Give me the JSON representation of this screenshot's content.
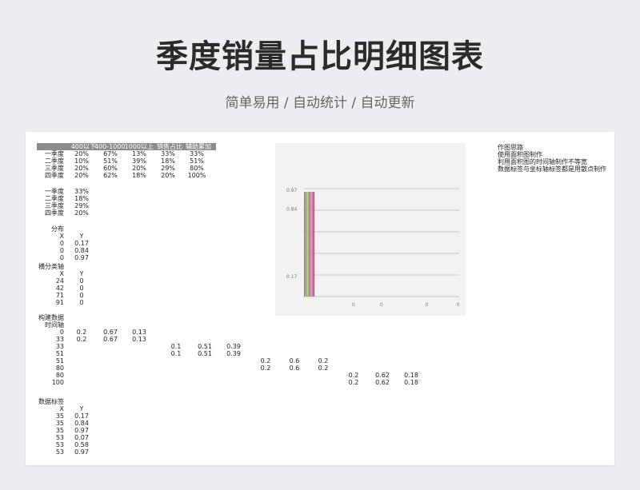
{
  "header": {
    "title": "季度销量占比明细图表",
    "subtitle": "简单易用 / 自动统计 / 自动更新"
  },
  "sheet": {
    "table1": {
      "headers": [
        "400以下",
        "400-1000",
        "1000以上",
        "销售占比",
        "辅助累加"
      ],
      "rows": [
        {
          "label": "一季度",
          "values": [
            "20%",
            "67%",
            "13%",
            "33%",
            "33%"
          ]
        },
        {
          "label": "二季度",
          "values": [
            "10%",
            "51%",
            "39%",
            "18%",
            "51%"
          ]
        },
        {
          "label": "三季度",
          "values": [
            "20%",
            "60%",
            "20%",
            "29%",
            "80%"
          ]
        },
        {
          "label": "四季度",
          "values": [
            "20%",
            "62%",
            "18%",
            "20%",
            "100%"
          ]
        }
      ]
    },
    "table2": {
      "rows": [
        {
          "label": "一季度",
          "value": "33%"
        },
        {
          "label": "二季度",
          "value": "18%"
        },
        {
          "label": "三季度",
          "value": "29%"
        },
        {
          "label": "四季度",
          "value": "20%"
        }
      ]
    },
    "distribution": {
      "title": "分布",
      "x_header": "X",
      "y_header": "Y",
      "rows": [
        [
          "0",
          "0.17"
        ],
        [
          "0",
          "0.84"
        ],
        [
          "0",
          "0.97"
        ]
      ]
    },
    "category_axis": {
      "title": "横分类轴",
      "x_header": "X",
      "y_header": "Y",
      "rows": [
        [
          "24",
          "0"
        ],
        [
          "42",
          "0"
        ],
        [
          "71",
          "0"
        ],
        [
          "91",
          "0"
        ]
      ]
    },
    "build": {
      "title": "构建数据",
      "subtitle": "时间轴",
      "rows": [
        {
          "t": "0",
          "cols": [
            [
              "0.2",
              "0.67",
              "0.13"
            ],
            null,
            null,
            null
          ]
        },
        {
          "t": "33",
          "cols": [
            [
              "0.2",
              "0.67",
              "0.13"
            ],
            null,
            null,
            null
          ]
        },
        {
          "t": "33",
          "cols": [
            null,
            [
              "0.1",
              "0.51",
              "0.39"
            ],
            null,
            null
          ]
        },
        {
          "t": "51",
          "cols": [
            null,
            [
              "0.1",
              "0.51",
              "0.39"
            ],
            null,
            null
          ]
        },
        {
          "t": "51",
          "cols": [
            null,
            null,
            [
              "0.2",
              "0.6",
              "0.2"
            ],
            null
          ]
        },
        {
          "t": "80",
          "cols": [
            null,
            null,
            [
              "0.2",
              "0.6",
              "0.2"
            ],
            null
          ]
        },
        {
          "t": "80",
          "cols": [
            null,
            null,
            null,
            [
              "0.2",
              "0.62",
              "0.18"
            ]
          ]
        },
        {
          "t": "100",
          "cols": [
            null,
            null,
            null,
            [
              "0.2",
              "0.62",
              "0.18"
            ]
          ]
        }
      ]
    },
    "data_labels": {
      "title": "数据标签",
      "x_header": "X",
      "y_header": "Y",
      "rows": [
        [
          "35",
          "0.17"
        ],
        [
          "35",
          "0.84"
        ],
        [
          "35",
          "0.97"
        ],
        [
          "53",
          "0.07"
        ],
        [
          "53",
          "0.58"
        ],
        [
          "53",
          "0.97"
        ]
      ]
    },
    "notes": [
      "作图思路",
      "使用面积图制作",
      "利用面积图的时间轴制作不等宽",
      "数据标签与坐标轴标签都是用散点制作"
    ]
  },
  "chart_data": {
    "type": "area",
    "y_tick_labels": [
      "0.97",
      "0.84",
      "0.17"
    ],
    "y_tick_values": [
      0.97,
      0.84,
      0.17
    ],
    "x_tick_labels": [
      "0",
      "0",
      "0",
      "0"
    ],
    "x_tick_positions": [
      24,
      42,
      71,
      91
    ],
    "gridline_count": 6,
    "stripes": [
      {
        "color": "#4f7fc2",
        "y_top": 0.97
      },
      {
        "color": "#e8a04a",
        "y_top": 0.97
      },
      {
        "color": "#9a9a9a",
        "y_top": 0.97
      },
      {
        "color": "#f0c419",
        "y_top": 0.97
      },
      {
        "color": "#5aa5d6",
        "y_top": 0.97
      },
      {
        "color": "#6ab04c",
        "y_top": 0.97
      },
      {
        "color": "#e96ca8",
        "y_top": 0.97
      },
      {
        "color": "#f28db2",
        "y_top": 0.97
      },
      {
        "color": "#d94f7a",
        "y_top": 0.97
      },
      {
        "color": "#c04a8c",
        "y_top": 0.97
      }
    ]
  }
}
